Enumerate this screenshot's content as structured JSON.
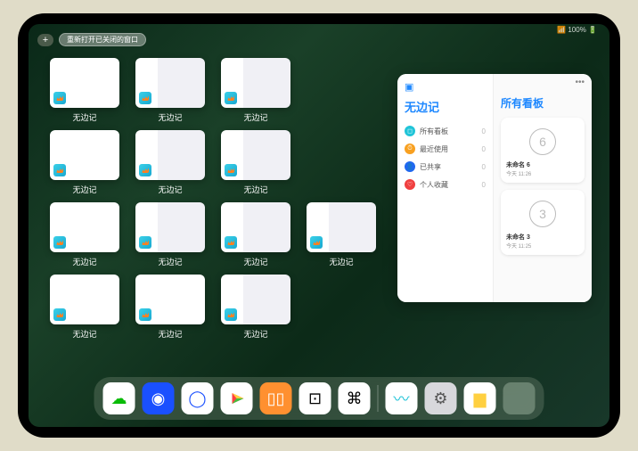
{
  "status_bar": "📶 100% 🔋",
  "topbar": {
    "plus": "+",
    "reopen_label": "重新打开已关闭的窗口"
  },
  "app_thumbs": {
    "label": "无边记",
    "items": [
      {
        "variant": "blank"
      },
      {
        "variant": "split"
      },
      {
        "variant": "split"
      },
      {
        "variant": "blank"
      },
      {
        "variant": "split"
      },
      {
        "variant": "split"
      },
      {
        "variant": "blank"
      },
      {
        "variant": "split"
      },
      {
        "variant": "split"
      },
      {
        "variant": "split"
      },
      {
        "variant": "blank"
      },
      {
        "variant": "blank"
      },
      {
        "variant": "split"
      }
    ]
  },
  "panel": {
    "left_icon": "▢",
    "left_title": "无边记",
    "items": [
      {
        "icon_color": "#20c4d8",
        "glyph": "◻",
        "label": "所有看板",
        "count": "0"
      },
      {
        "icon_color": "#f8a020",
        "glyph": "⏱",
        "label": "最近使用",
        "count": "0"
      },
      {
        "icon_color": "#2068f0",
        "glyph": "👤",
        "label": "已共享",
        "count": "0"
      },
      {
        "icon_color": "#f04040",
        "glyph": "♡",
        "label": "个人收藏",
        "count": "0"
      }
    ],
    "right_title": "所有看板",
    "more": "•••",
    "boards": [
      {
        "digit": "6",
        "name": "未命名 6",
        "sub": "今天 11:26"
      },
      {
        "digit": "3",
        "name": "未命名 3",
        "sub": "今天 11:25"
      }
    ]
  },
  "dock": {
    "icons": [
      {
        "name": "wechat",
        "bg": "#fff",
        "fg": "#09bb07",
        "glyph": "☁"
      },
      {
        "name": "quark-hd",
        "bg": "#1a50ff",
        "fg": "#fff",
        "glyph": "◉"
      },
      {
        "name": "quark",
        "bg": "#fff",
        "fg": "#1a50ff",
        "glyph": "◯"
      },
      {
        "name": "play",
        "bg": "#fff",
        "fg": "",
        "glyph": "▶",
        "multicolor": true
      },
      {
        "name": "books",
        "bg": "#ff9030",
        "fg": "#fff",
        "glyph": "▯▯"
      },
      {
        "name": "dice",
        "bg": "#fff",
        "fg": "#000",
        "glyph": "⊡"
      },
      {
        "name": "nodes",
        "bg": "#fff",
        "fg": "#000",
        "glyph": "⌘"
      }
    ],
    "recent": [
      {
        "name": "freeform",
        "bg": "#fff",
        "fg": "#20c4d8",
        "glyph": "〰"
      },
      {
        "name": "settings",
        "bg": "#d8d8dc",
        "fg": "#555",
        "glyph": "⚙"
      },
      {
        "name": "notes",
        "bg": "#fff",
        "fg": "#ffd040",
        "glyph": "▆"
      }
    ],
    "folder_colors": [
      "#3adafc",
      "#94d870",
      "#68b0ff",
      "#ffffff"
    ]
  }
}
